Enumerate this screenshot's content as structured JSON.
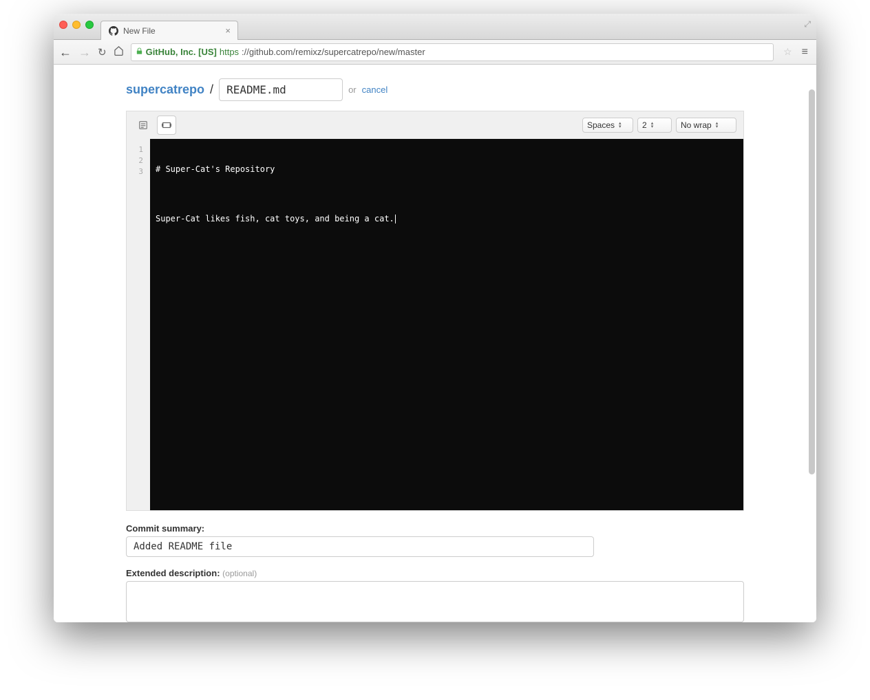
{
  "browser": {
    "tab_title": "New File",
    "cert_label": "GitHub, Inc. [US]",
    "url_protocol": "https",
    "url_path": "://github.com/remixz/supercatrepo/new/master"
  },
  "breadcrumb": {
    "repo_name": "supercatrepo",
    "slash": "/",
    "filename_value": "README.md",
    "or_text": "or",
    "cancel_text": "cancel"
  },
  "editor": {
    "indent_mode": "Spaces",
    "indent_size": "2",
    "wrap_mode": "No wrap",
    "line_numbers": [
      "1",
      "2",
      "3"
    ],
    "lines": [
      "# Super-Cat's Repository",
      "",
      "Super-Cat likes fish, cat toys, and being a cat."
    ]
  },
  "commit": {
    "summary_label": "Commit summary:",
    "summary_value": "Added README file",
    "extended_label": "Extended description:",
    "extended_optional": "(optional)"
  }
}
